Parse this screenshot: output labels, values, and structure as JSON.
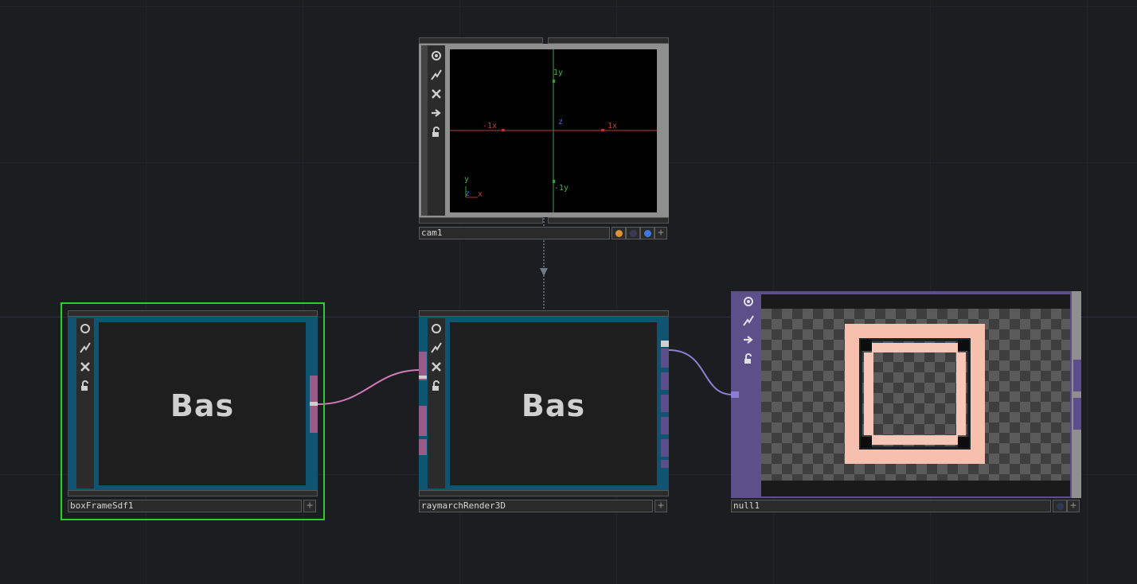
{
  "nodes": {
    "cam": {
      "name": "cam1",
      "axes": {
        "pos_x": "1x",
        "neg_x": "-1x",
        "pos_y": "1y",
        "neg_y": "-1y",
        "z": "z"
      },
      "gizmo": {
        "y": "y",
        "x": "x",
        "z": "z"
      },
      "flags": [
        "orange",
        "dark",
        "blue"
      ]
    },
    "boxframe": {
      "name": "boxFrameSdf1",
      "viewer_text": "Bas",
      "selected": true
    },
    "raymarch": {
      "name": "raymarchRender3D",
      "viewer_text": "Bas"
    },
    "null": {
      "name": "null1"
    }
  },
  "toolbar_icons": [
    "viewer-toggle-icon",
    "bypass-icon",
    "delete-icon",
    "display-icon",
    "lock-icon"
  ],
  "plus_label": "+",
  "colors": {
    "background": "#1c1d21",
    "selected_outline": "#24d424",
    "sdf_border": "#0f5470",
    "wire_sdf": "#d17ab9",
    "wire_tex": "#8a7fd0",
    "null_border": "#5d4f8a",
    "frame_peach": "#f7bfae"
  }
}
